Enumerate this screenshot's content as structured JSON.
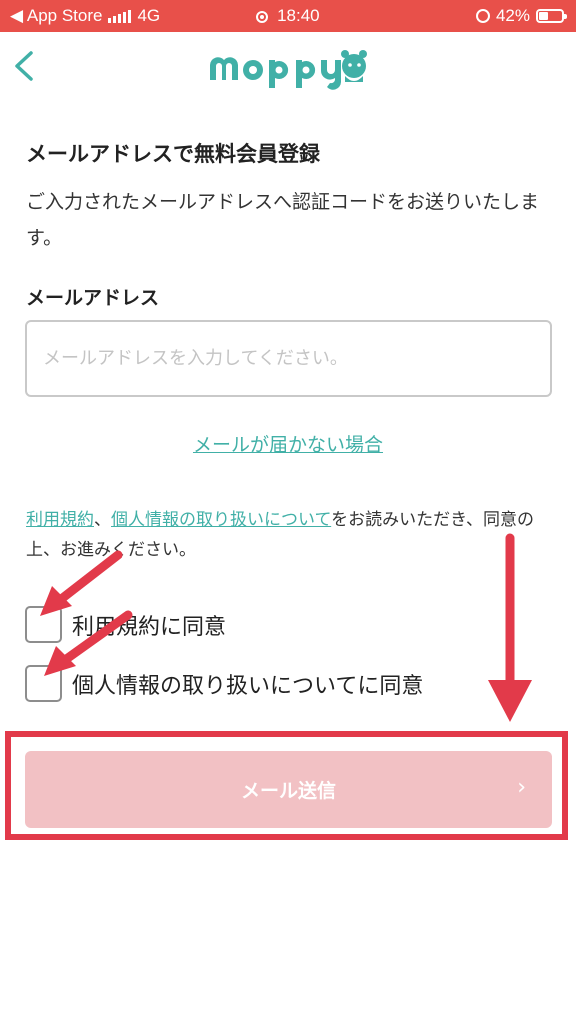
{
  "status_bar": {
    "carrier": "◀ App Store",
    "network": "4G",
    "time": "18:40",
    "battery": "42%",
    "background": "#e8504a"
  },
  "header": {
    "back_icon": "chevron-left-icon",
    "logo_alt": "moppy"
  },
  "page": {
    "title": "メールアドレスで無料会員登録",
    "description": "ご入力されたメールアドレスへ認証コードをお送りいたします。",
    "email_label": "メールアドレス",
    "email_placeholder": "メールアドレスを入力してください。",
    "email_value": "",
    "no_mail_link": "メールが届かない場合",
    "terms": {
      "link_terms": "利用規約",
      "separator": "、",
      "link_privacy": "個人情報の取り扱いについて",
      "suffix": "をお読みいただき、同意の上、お進みください。"
    },
    "checkboxes": [
      {
        "label": "利用規約に同意",
        "checked": false
      },
      {
        "label": "個人情報の取り扱いについてに同意",
        "checked": false
      }
    ],
    "submit_label": "メール送信",
    "submit_chevron": "›"
  },
  "colors": {
    "accent": "#41b0a7",
    "annotation_red": "#e23a4a",
    "submit_disabled": "#f2c1c4"
  }
}
